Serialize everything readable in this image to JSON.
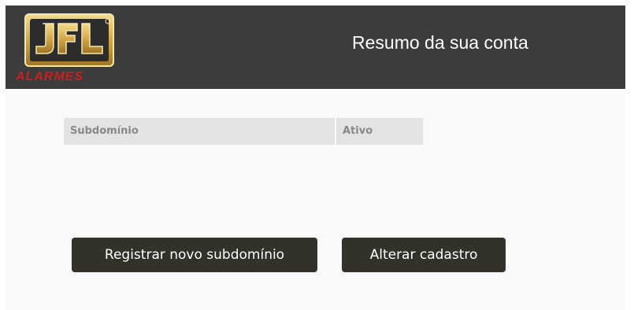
{
  "header": {
    "logo_text_main": "JFL",
    "logo_text_sub": "ALARMES",
    "title": "Resumo da sua conta"
  },
  "table": {
    "columns": [
      "Subdomínio",
      "Ativo"
    ]
  },
  "actions": {
    "register_label": "Registrar novo subdomínio",
    "edit_label": "Alterar cadastro"
  },
  "colors": {
    "header_bg": "#3c3c3c",
    "button_bg": "#32322a",
    "logo_gold": "#d4a84a",
    "logo_red": "#c8201e"
  }
}
